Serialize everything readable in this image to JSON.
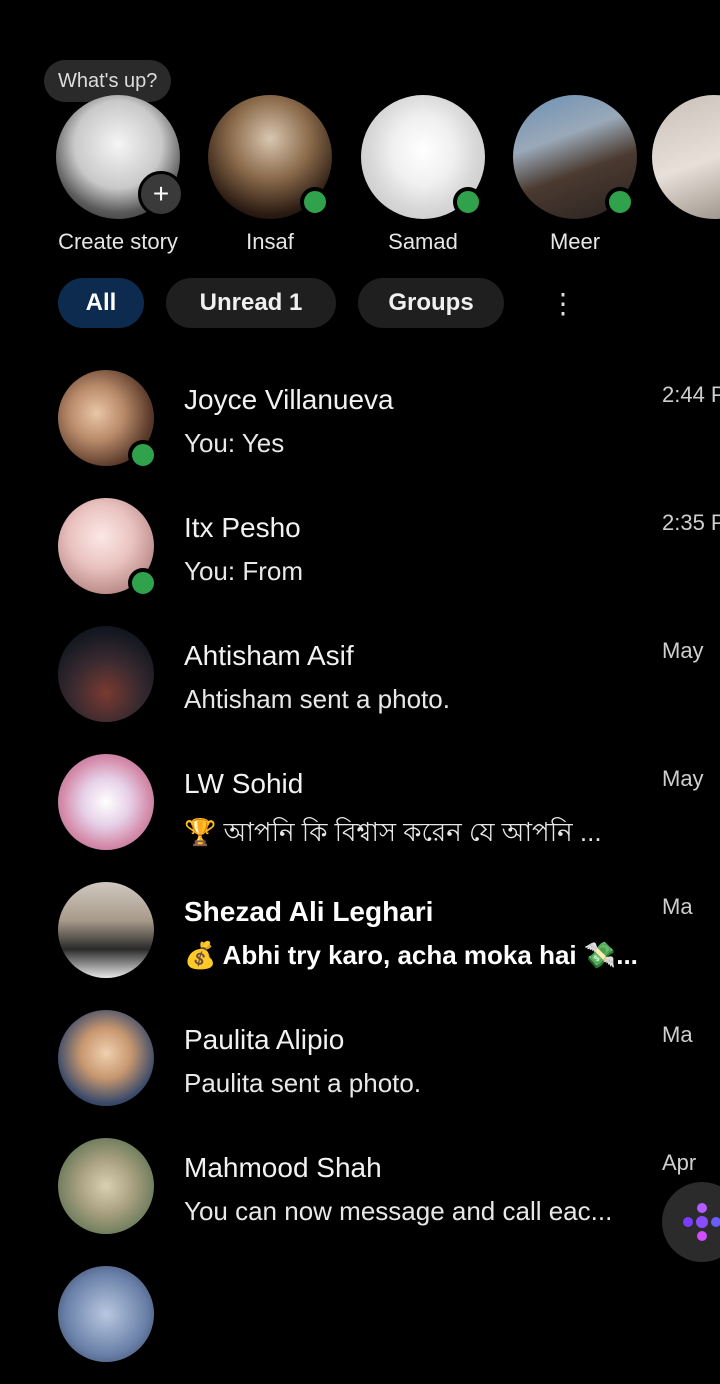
{
  "note": {
    "text": "What's up?"
  },
  "stories": [
    {
      "name": "Create story",
      "add_symbol": "+",
      "online": false
    },
    {
      "name": "Insaf",
      "online": true
    },
    {
      "name": "Samad",
      "online": true
    },
    {
      "name": "Meer",
      "online": true
    },
    {
      "name": "",
      "online": false
    }
  ],
  "filters": {
    "all": "All",
    "unread": "Unread 1",
    "groups": "Groups",
    "more_icon": "⋮"
  },
  "chats": [
    {
      "name": "Joyce Villanueva",
      "snippet": "You: Yes",
      "time": "2:44 P",
      "online": true,
      "unread": false
    },
    {
      "name": "Itx Pesho",
      "snippet": "You: From",
      "time": "2:35 P",
      "online": true,
      "unread": false
    },
    {
      "name": "Ahtisham Asif",
      "snippet": "Ahtisham sent a photo.",
      "time": "May",
      "online": false,
      "unread": false
    },
    {
      "name": "LW Sohid",
      "snippet": "🏆 আপনি কি বিশ্বাস করেন যে আপনি ...",
      "time": "May",
      "online": false,
      "unread": false
    },
    {
      "name": "Shezad Ali Leghari",
      "snippet": "💰 Abhi try karo, acha moka hai 💸...",
      "time": "Ma",
      "online": false,
      "unread": true
    },
    {
      "name": "Paulita Alipio",
      "snippet": "Paulita sent a photo.",
      "time": "Ma",
      "online": false,
      "unread": false
    },
    {
      "name": "Mahmood Shah",
      "snippet": "You can now message and call eac...",
      "time": "Apr",
      "online": false,
      "unread": false
    }
  ],
  "colors": {
    "background": "#000000",
    "active_dot": "#31a24c",
    "active_chip": "#0d2b4f",
    "chip": "#1f1f1f"
  },
  "icons": {
    "fab": "ai-sparkle-icon"
  }
}
